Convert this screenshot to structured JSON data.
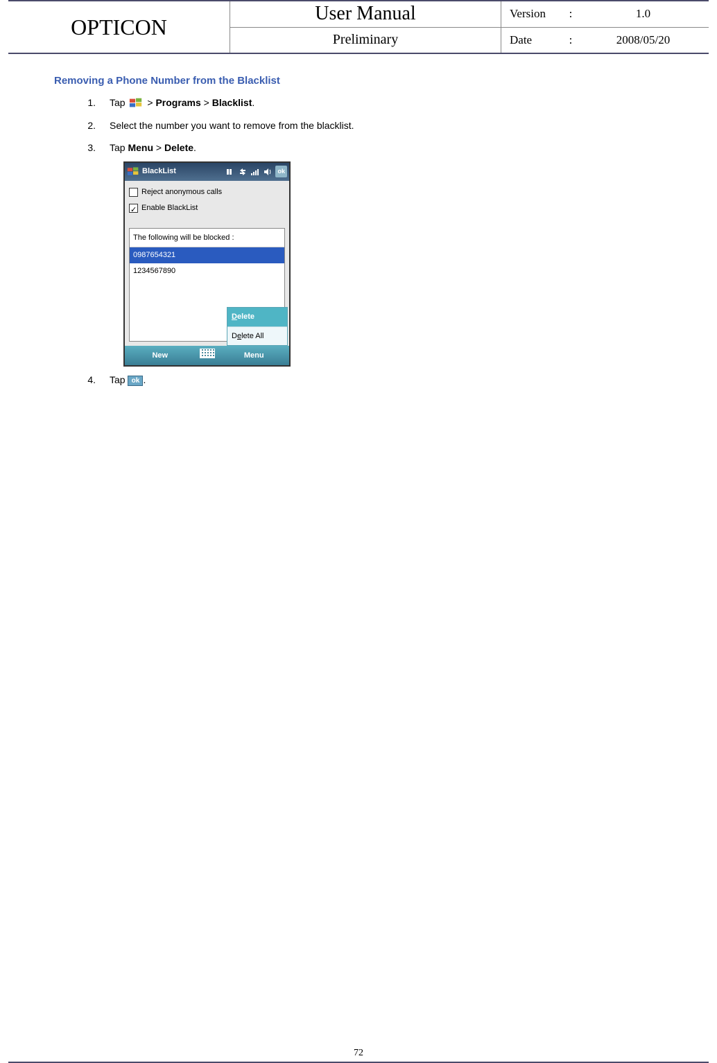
{
  "header": {
    "brand": "OPTICON",
    "title": "User Manual",
    "subtitle": "Preliminary",
    "version_label": "Version",
    "version_value": "1.0",
    "date_label": "Date",
    "date_value": "2008/05/20"
  },
  "section": {
    "heading": "Removing a Phone Number from the Blacklist"
  },
  "steps": {
    "s1_num": "1.",
    "s1_a": "Tap ",
    "s1_b": " > ",
    "s1_prog": "Programs",
    "s1_c": " > ",
    "s1_black": "Blacklist",
    "s1_end": ".",
    "s2_num": "2.",
    "s2_text": "Select the number you want to remove from the blacklist.",
    "s3_num": "3.",
    "s3_a": "Tap ",
    "s3_menu": "Menu",
    "s3_b": " > ",
    "s3_del": "Delete",
    "s3_end": ".",
    "s4_num": "4.",
    "s4_a": "Tap ",
    "s4_end": "."
  },
  "phone": {
    "title": "BlackList",
    "ok": "ok",
    "cb1_label": "Reject anonymous calls",
    "cb2_label": "Enable BlackList",
    "blocked_header": "The following will be blocked :",
    "num1": "0987654321",
    "num2": "1234567890",
    "popup_delete": "Delete",
    "popup_delete_all_pre": "D",
    "popup_delete_all_u": "e",
    "popup_delete_all_post": "lete All",
    "bb_new": "New",
    "bb_menu": "Menu"
  },
  "ok_small": "ok",
  "page_number": "72"
}
